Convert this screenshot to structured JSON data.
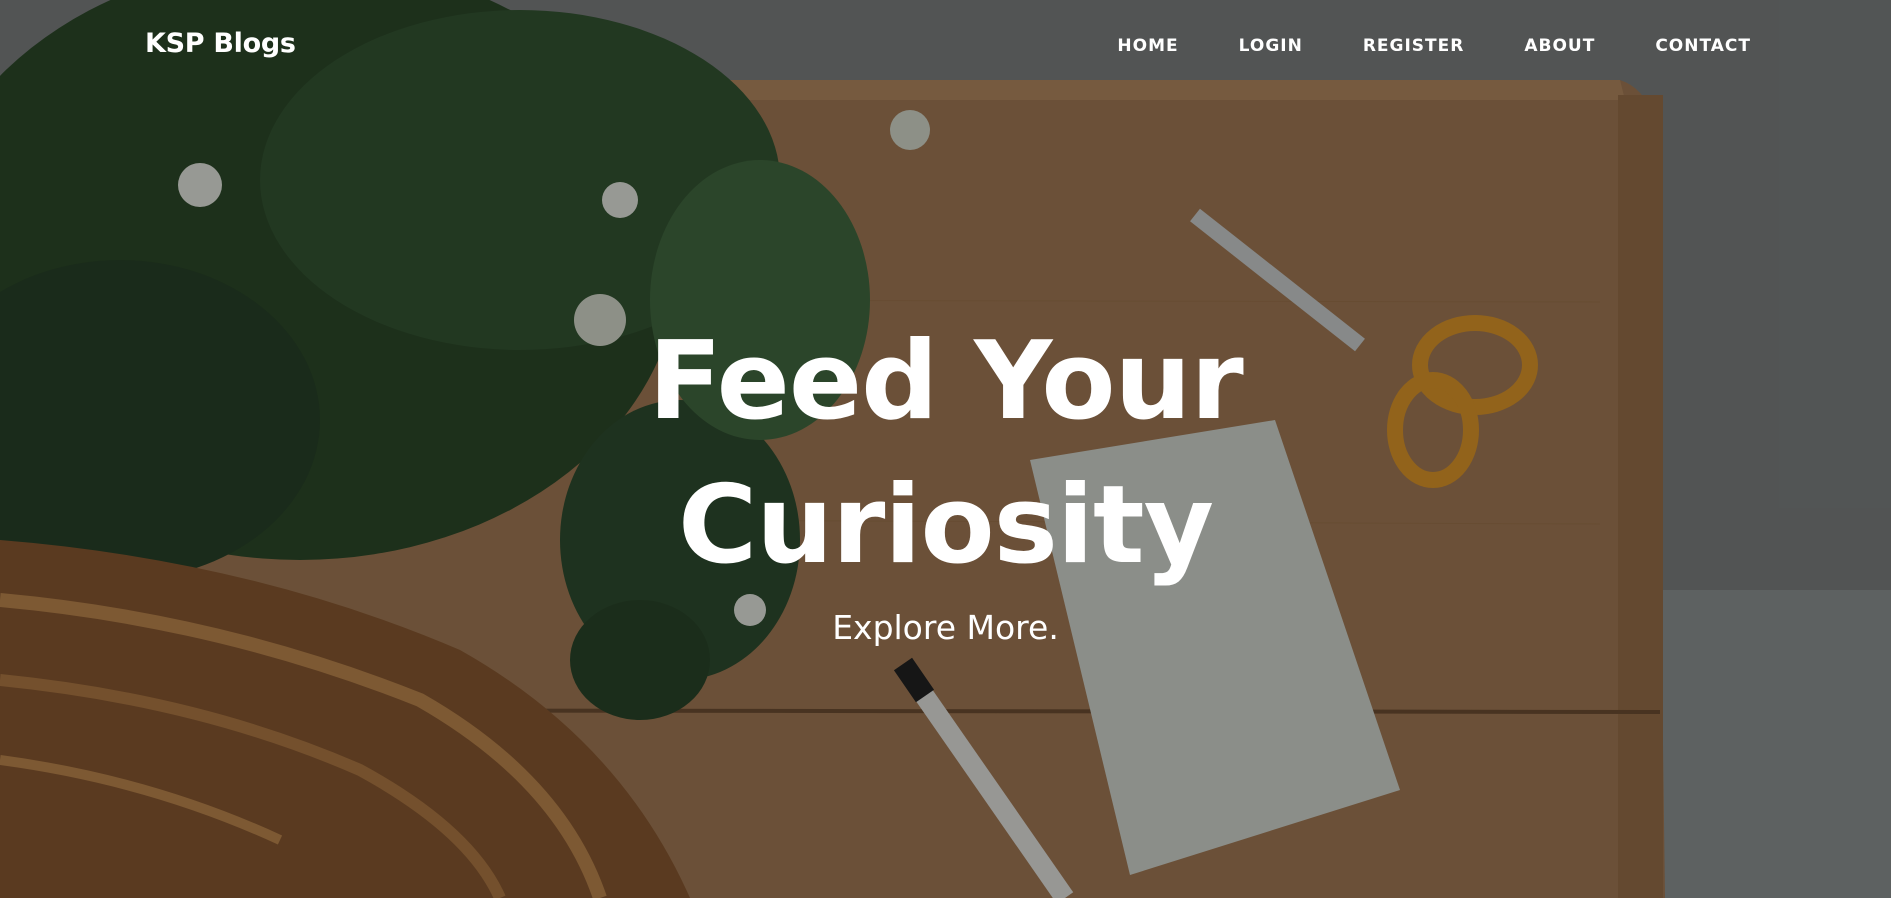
{
  "navbar": {
    "brand": "KSP Blogs",
    "items": [
      {
        "label": "HOME"
      },
      {
        "label": "LOGIN"
      },
      {
        "label": "REGISTER"
      },
      {
        "label": "ABOUT"
      },
      {
        "label": "CONTACT"
      }
    ]
  },
  "hero": {
    "title": "Feed Your Curiosity",
    "subtitle": "Explore More."
  },
  "colors": {
    "text": "#ffffff",
    "overlay": "#000000",
    "table_wood": "#a57c56",
    "scissors_handle": "#e0982a"
  }
}
